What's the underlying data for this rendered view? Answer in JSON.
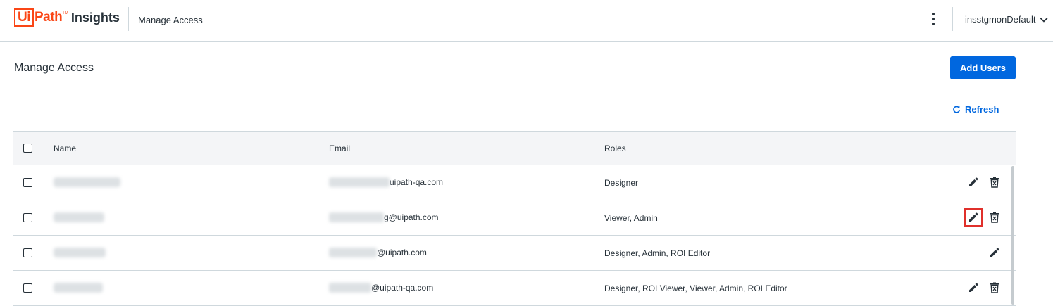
{
  "header": {
    "logo_ui": "Ui",
    "logo_path": "Path",
    "logo_tm": "TM",
    "logo_product": "Insights",
    "breadcrumb": "Manage Access",
    "tenant": "insstgmonDefault"
  },
  "page": {
    "title": "Manage Access",
    "add_users_label": "Add Users",
    "refresh_label": "Refresh"
  },
  "table": {
    "columns": [
      "Name",
      "Email",
      "Roles"
    ],
    "rows": [
      {
        "email_domain": "uipath-qa.com",
        "roles": "Designer",
        "can_delete": true
      },
      {
        "email_domain": "g@uipath.com",
        "roles": "Viewer, Admin",
        "can_delete": true
      },
      {
        "email_domain": "@uipath.com",
        "roles": "Designer, Admin, ROI Editor",
        "can_delete": false
      },
      {
        "email_domain": "@uipath-qa.com",
        "roles": "Designer, ROI Viewer, Viewer, Admin, ROI Editor",
        "can_delete": true
      }
    ]
  },
  "colors": {
    "brand": "#fa4616",
    "primary": "#0067df",
    "highlight": "#e0302b"
  }
}
